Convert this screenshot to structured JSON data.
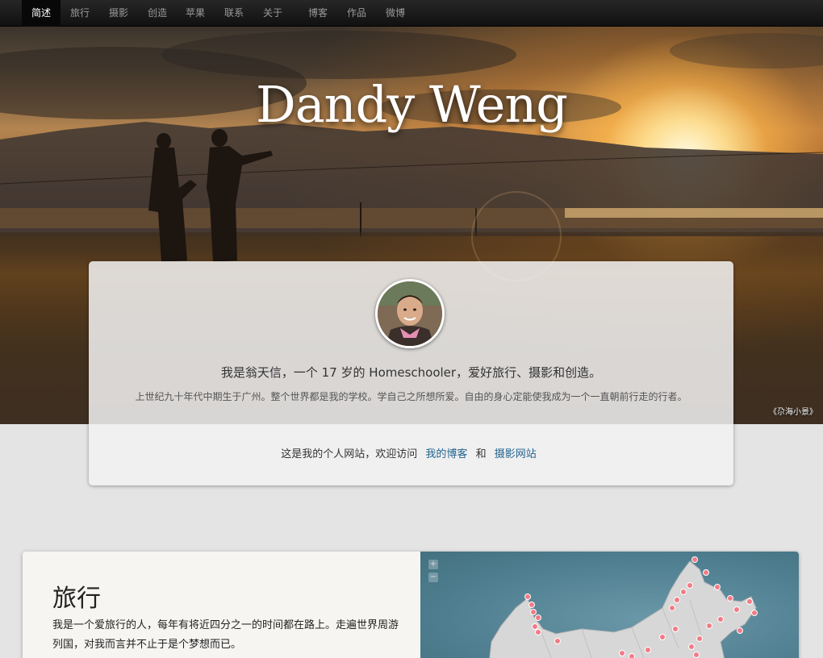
{
  "nav": {
    "items": [
      {
        "label": "简述",
        "active": true
      },
      {
        "label": "旅行"
      },
      {
        "label": "摄影"
      },
      {
        "label": "创造"
      },
      {
        "label": "苹果"
      },
      {
        "label": "联系"
      },
      {
        "label": "关于"
      },
      {
        "label": "博客"
      },
      {
        "label": "作品"
      },
      {
        "label": "微博"
      }
    ]
  },
  "hero": {
    "title": "Dandy Weng",
    "photo_caption": "《尕海小景》"
  },
  "profile": {
    "intro": "我是翁天信，一个 17 岁的 Homeschooler，爱好旅行、摄影和创造。",
    "subtitle": "上世纪九十年代中期生于广州。整个世界都是我的学校。学自己之所想所爱。自由的身心定能使我成为一个一直朝前行走的行者。",
    "visit_prefix": "这是我的个人网站，欢迎访问",
    "blog_link": "我的博客",
    "and_text": "和",
    "photo_link": "摄影网站"
  },
  "travel": {
    "title": "旅行",
    "text": "我是一个爱旅行的人，每年有将近四分之一的时间都在路上。走遍世界周游列国，对我而言并不止于是个梦想而已。",
    "map": {
      "zoom_in": "+",
      "zoom_out": "−",
      "marker_color": "#f27b86"
    }
  }
}
